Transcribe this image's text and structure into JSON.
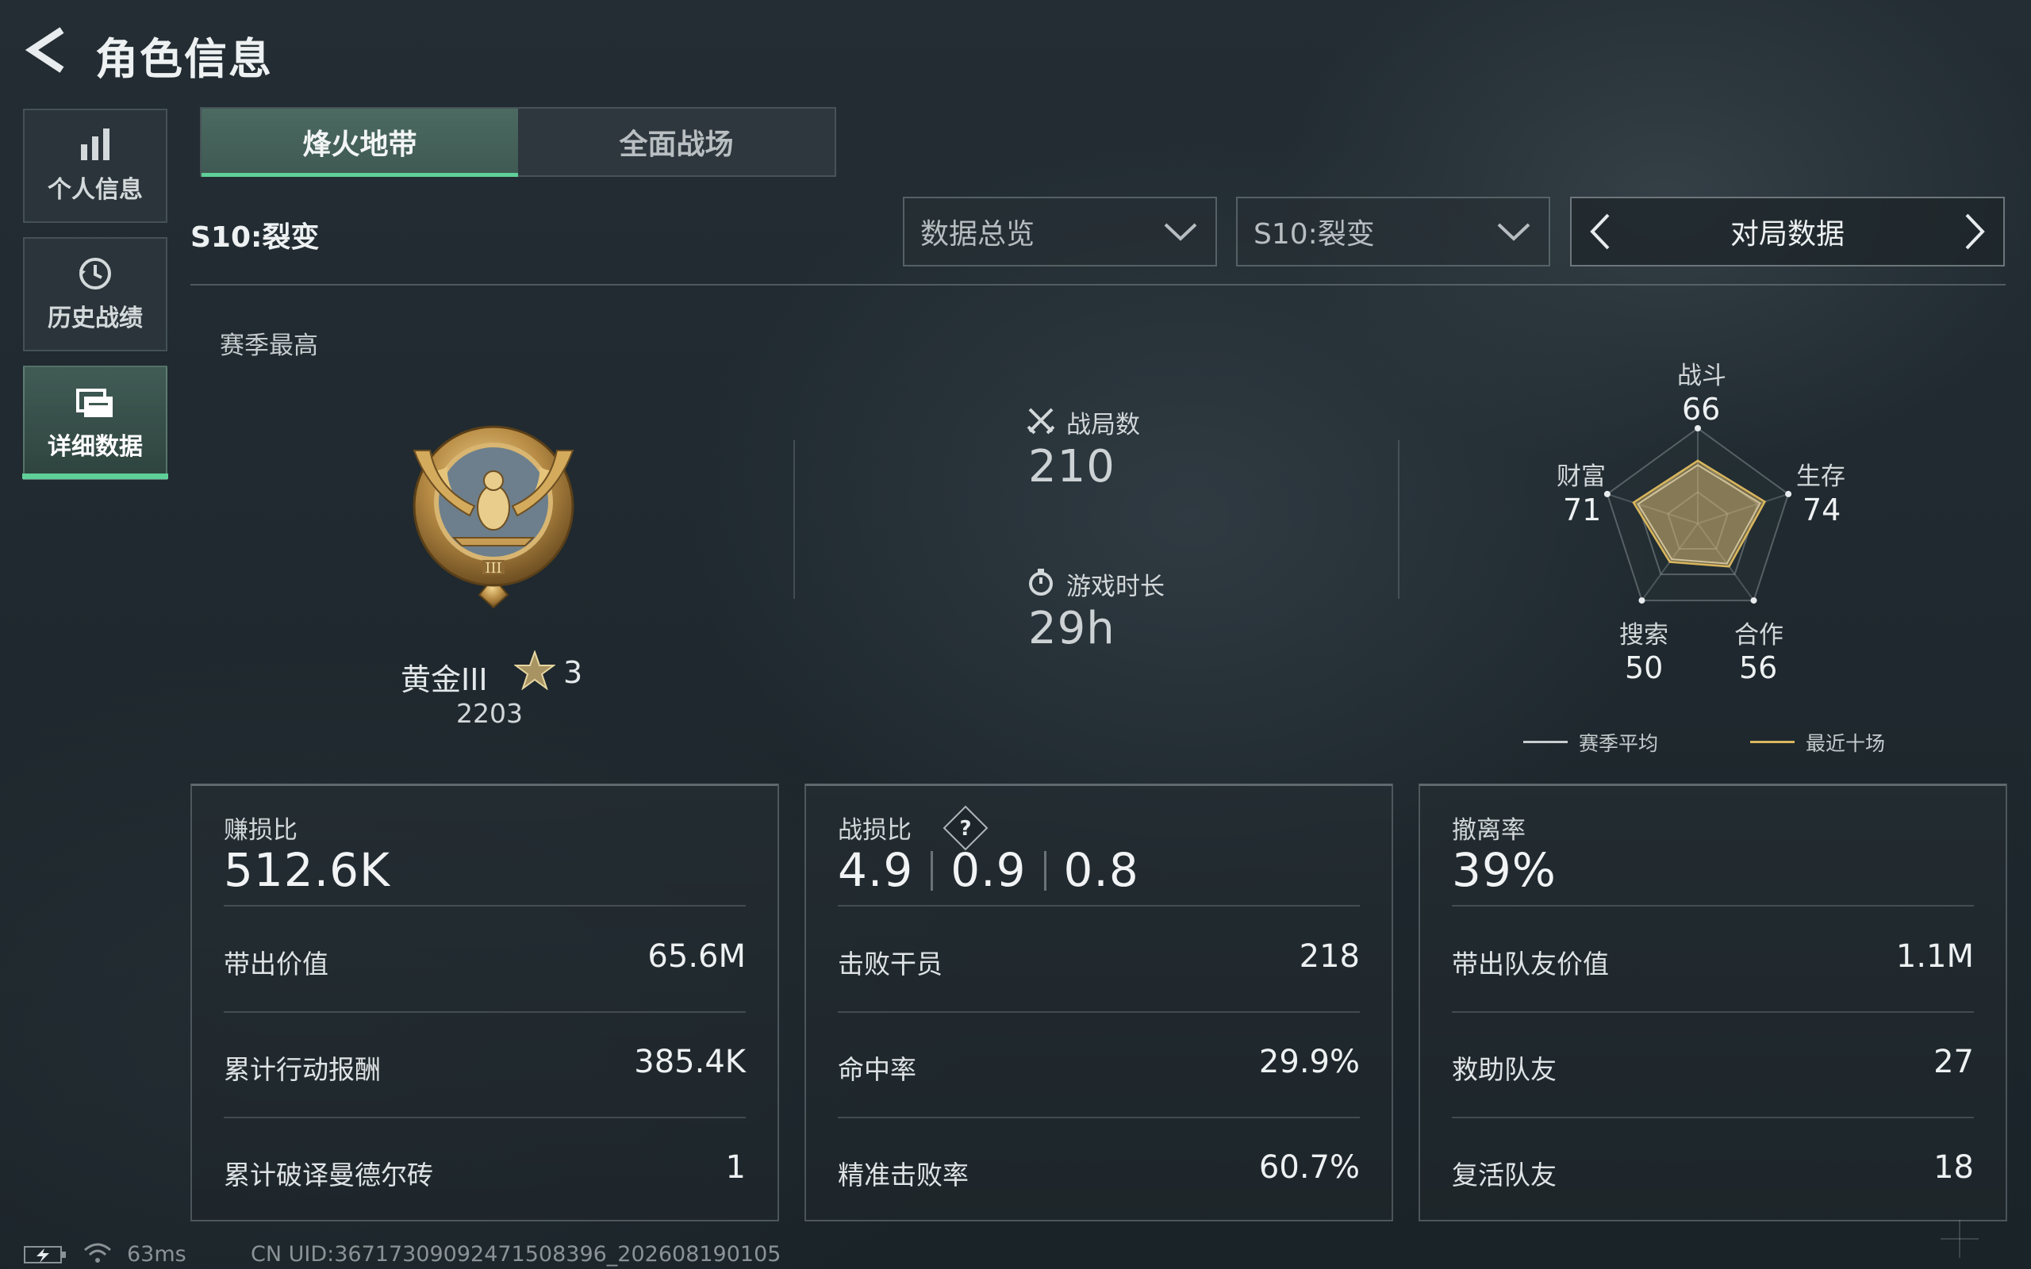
{
  "header": {
    "title": "角色信息"
  },
  "sidebar": {
    "items": [
      {
        "label": "个人信息",
        "icon": "bar-chart-icon"
      },
      {
        "label": "历史战绩",
        "icon": "history-clock-icon"
      },
      {
        "label": "详细数据",
        "icon": "folder-data-icon",
        "active": true
      }
    ]
  },
  "mode_tabs": [
    {
      "label": "烽火地带",
      "active": true
    },
    {
      "label": "全面战场",
      "active": false
    }
  ],
  "filters": {
    "season_label": "S10:裂变",
    "data_scope": "数据总览",
    "season_select": "S10:裂变",
    "pager_label": "对局数据"
  },
  "rank": {
    "section_label": "赛季最高",
    "name": "黄金III",
    "stars": "3",
    "score": "2203"
  },
  "summary": {
    "matches_label": "战局数",
    "matches_value": "210",
    "playtime_label": "游戏时长",
    "playtime_value": "29h"
  },
  "radar": {
    "axes": [
      {
        "label": "战斗",
        "value": "66"
      },
      {
        "label": "生存",
        "value": "74"
      },
      {
        "label": "合作",
        "value": "56"
      },
      {
        "label": "搜索",
        "value": "50"
      },
      {
        "label": "财富",
        "value": "71"
      }
    ],
    "legend": [
      {
        "label": "赛季平均",
        "color": "#c8cdd0"
      },
      {
        "label": "最近十场",
        "color": "#d9b65e"
      }
    ]
  },
  "cards": [
    {
      "title": "赚损比",
      "main": "512.6K",
      "rows": [
        {
          "label": "带出价值",
          "value": "65.6M"
        },
        {
          "label": "累计行动报酬",
          "value": "385.4K"
        },
        {
          "label": "累计破译曼德尔砖",
          "value": "1"
        }
      ]
    },
    {
      "title": "战损比",
      "main_parts": [
        "4.9",
        "0.9",
        "0.8"
      ],
      "rows": [
        {
          "label": "击败干员",
          "value": "218"
        },
        {
          "label": "命中率",
          "value": "29.9%"
        },
        {
          "label": "精准击败率",
          "value": "60.7%"
        }
      ]
    },
    {
      "title": "撤离率",
      "main": "39%",
      "rows": [
        {
          "label": "带出队友价值",
          "value": "1.1M"
        },
        {
          "label": "救助队友",
          "value": "27"
        },
        {
          "label": "复活队友",
          "value": "18"
        }
      ]
    }
  ],
  "footer": {
    "ping": "63ms",
    "uid": "CN UID:3671730909247150839​6_202608190105"
  },
  "colors": {
    "accent_green": "#5fcf98",
    "recent_gold": "#d9b65e"
  }
}
